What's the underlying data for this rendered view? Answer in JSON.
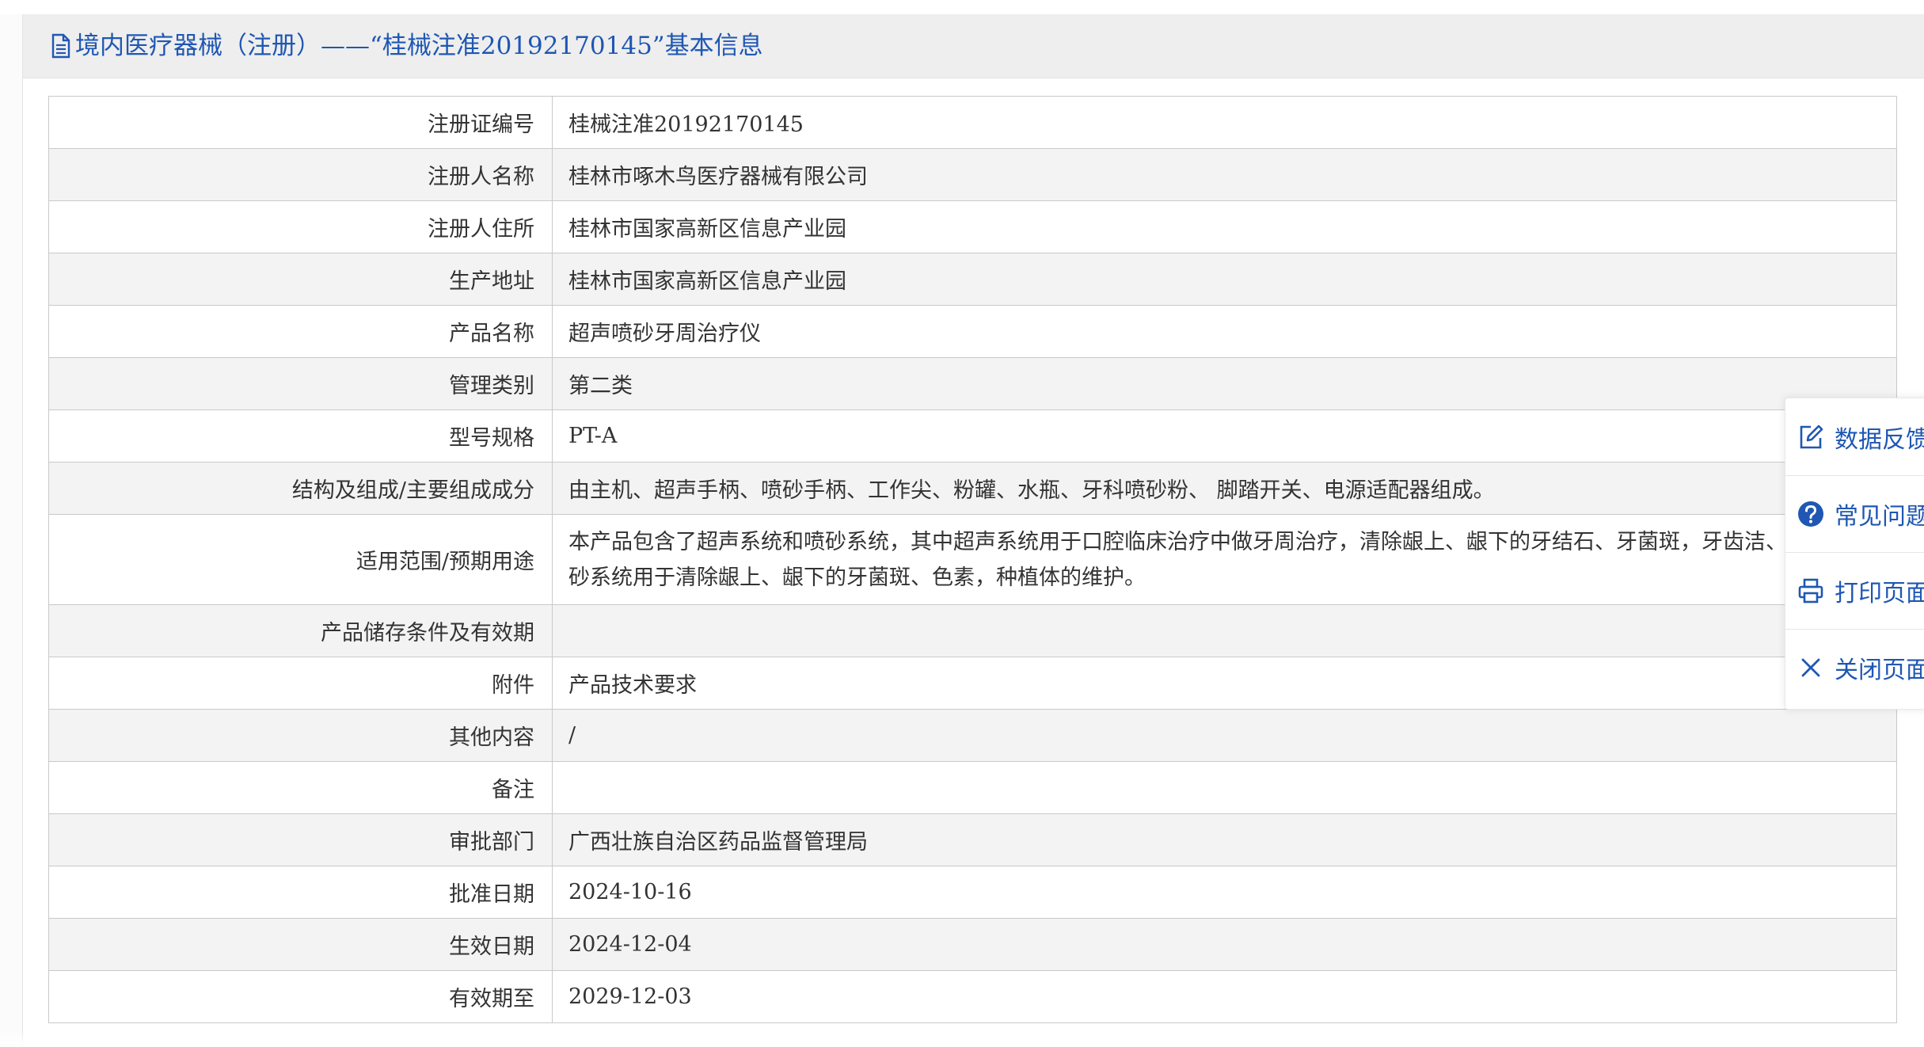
{
  "header": {
    "title": "境内医疗器械（注册）——“桂械注准20192170145”基本信息"
  },
  "rows": [
    {
      "label": "注册证编号",
      "value": "桂械注准20192170145"
    },
    {
      "label": "注册人名称",
      "value": "桂林市啄木鸟医疗器械有限公司"
    },
    {
      "label": "注册人住所",
      "value": "桂林市国家高新区信息产业园"
    },
    {
      "label": "生产地址",
      "value": "桂林市国家高新区信息产业园"
    },
    {
      "label": "产品名称",
      "value": "超声喷砂牙周治疗仪"
    },
    {
      "label": "管理类别",
      "value": "第二类"
    },
    {
      "label": "型号规格",
      "value": "PT-A"
    },
    {
      "label": "结构及组成/主要组成成分",
      "value": "由主机、超声手柄、喷砂手柄、工作尖、粉罐、水瓶、牙科喷砂粉、 脚踏开关、电源适配器组成。"
    },
    {
      "label": "适用范围/预期用途",
      "value": "本产品包含了超声系统和喷砂系统，其中超声系统用于口腔临床治疗中做牙周治疗，清除龈上、龈下的牙结石、牙菌斑，牙齿洁、荡洗；喷砂系统用于清除龈上、龈下的牙菌斑、色素，种植体的维护。"
    },
    {
      "label": "产品储存条件及有效期",
      "value": ""
    },
    {
      "label": "附件",
      "value": "产品技术要求"
    },
    {
      "label": "其他内容",
      "value": "/"
    },
    {
      "label": "备注",
      "value": ""
    },
    {
      "label": "审批部门",
      "value": "广西壮族自治区药品监督管理局"
    },
    {
      "label": "批准日期",
      "value": "2024-10-16"
    },
    {
      "label": "生效日期",
      "value": "2024-12-04"
    },
    {
      "label": "有效期至",
      "value": "2029-12-03"
    }
  ],
  "float_menu": {
    "items": [
      {
        "label": "数据反馈",
        "icon": "edit-icon"
      },
      {
        "label": "常见问题",
        "icon": "help-icon"
      },
      {
        "label": "打印页面",
        "icon": "print-icon"
      },
      {
        "label": "关闭页面",
        "icon": "close-icon"
      }
    ]
  },
  "colors": {
    "accent": "#1f57b3",
    "text": "#333333",
    "border": "#c9c9c9",
    "stripe": "#f3f3f3",
    "header_bg": "#eeeeee"
  }
}
